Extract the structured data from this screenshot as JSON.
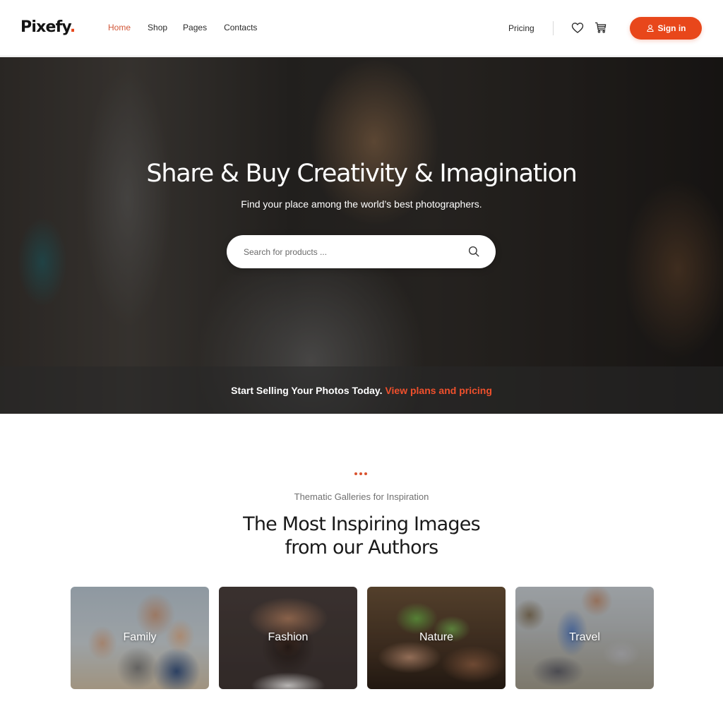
{
  "header": {
    "logo": "Pixefy",
    "logo_dot": ".",
    "nav": [
      {
        "label": "Home",
        "active": true
      },
      {
        "label": "Shop",
        "active": false
      },
      {
        "label": "Pages",
        "active": false
      },
      {
        "label": "Contacts",
        "active": false
      }
    ],
    "pricing_label": "Pricing",
    "icons": {
      "wishlist": "heart-icon",
      "cart": "cart-icon",
      "user": "user-icon"
    },
    "signin_label": "Sign in"
  },
  "hero": {
    "title": "Share & Buy Creativity & Imagination",
    "subtitle": "Find your place among the world’s best photographers.",
    "search": {
      "placeholder": "Search for products ...",
      "value": "",
      "icon": "search-icon"
    },
    "band_text": "Start Selling Your Photos Today.",
    "band_link": "View plans and pricing"
  },
  "gallery": {
    "kicker": "Thematic Galleries for Inspiration",
    "title_line1": "The Most Inspiring Images",
    "title_line2": "from our Authors",
    "cards": [
      {
        "label": "Family"
      },
      {
        "label": "Fashion"
      },
      {
        "label": "Nature"
      },
      {
        "label": "Travel"
      }
    ]
  },
  "colors": {
    "accent": "#e8471b",
    "nav_active": "#d2583a",
    "text_dark": "#1a1a1a",
    "text_muted": "#707070"
  }
}
